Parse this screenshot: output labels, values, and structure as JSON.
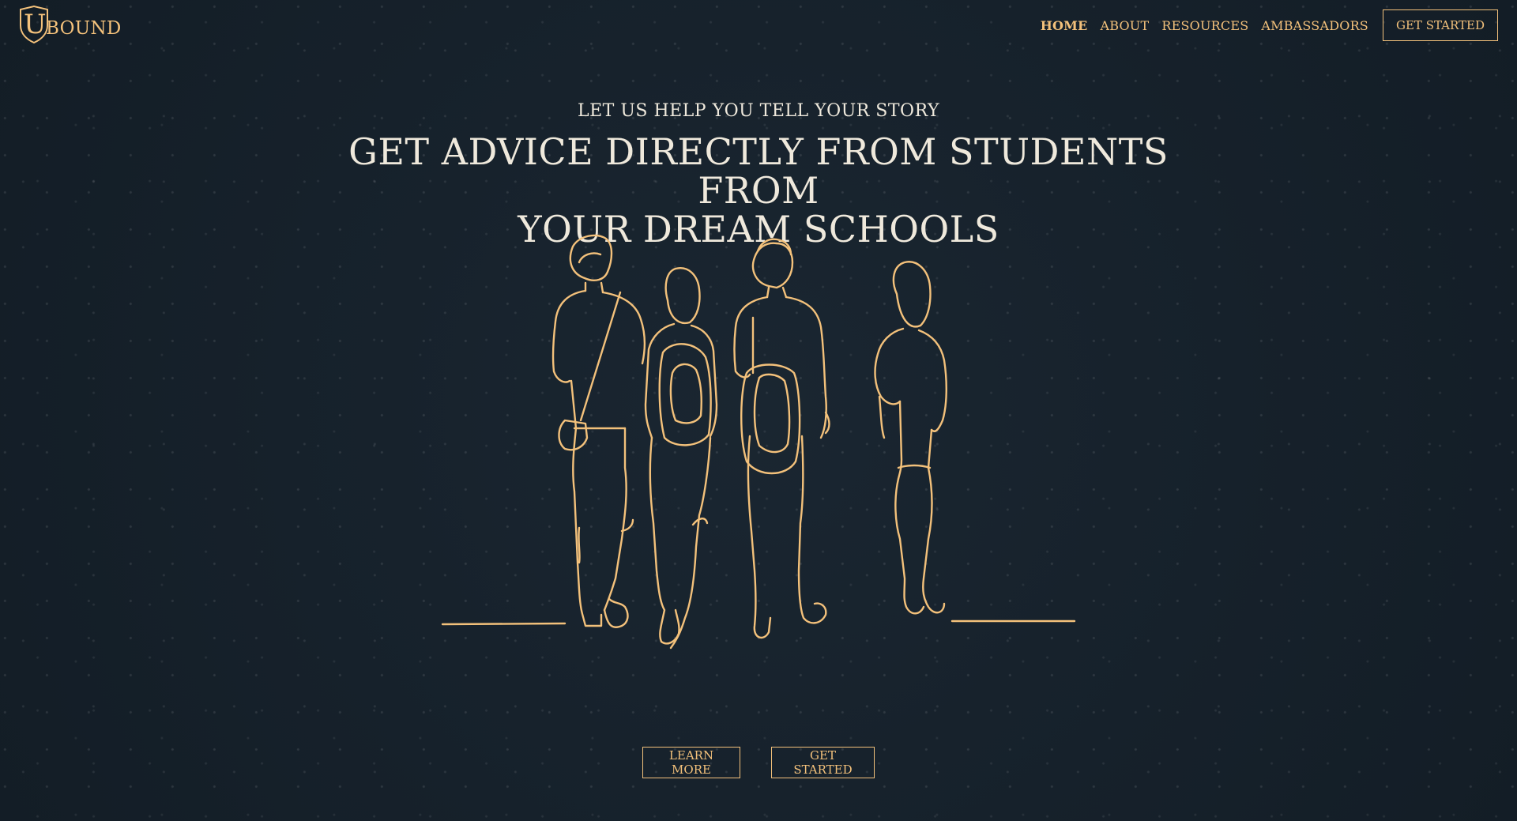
{
  "brand": {
    "logo_letter": "U",
    "logo_text": "BOUND",
    "accent_color": "#f3c17b",
    "background_color": "#16212b"
  },
  "nav": {
    "items": [
      {
        "label": "HOME",
        "active": true
      },
      {
        "label": "ABOUT",
        "active": false
      },
      {
        "label": "RESOURCES",
        "active": false
      },
      {
        "label": "AMBASSADORS",
        "active": false
      }
    ],
    "cta_label": "GET STARTED"
  },
  "hero": {
    "eyebrow": "LET US HELP YOU TELL YOUR STORY",
    "title_line1": "GET ADVICE DIRECTLY FROM STUDENTS FROM",
    "title_line2": "YOUR DREAM SCHOOLS",
    "illustration_icon": "four-students-walking-line-art",
    "buttons": {
      "learn_more": "LEARN MORE",
      "get_started": "GET STARTED"
    }
  }
}
